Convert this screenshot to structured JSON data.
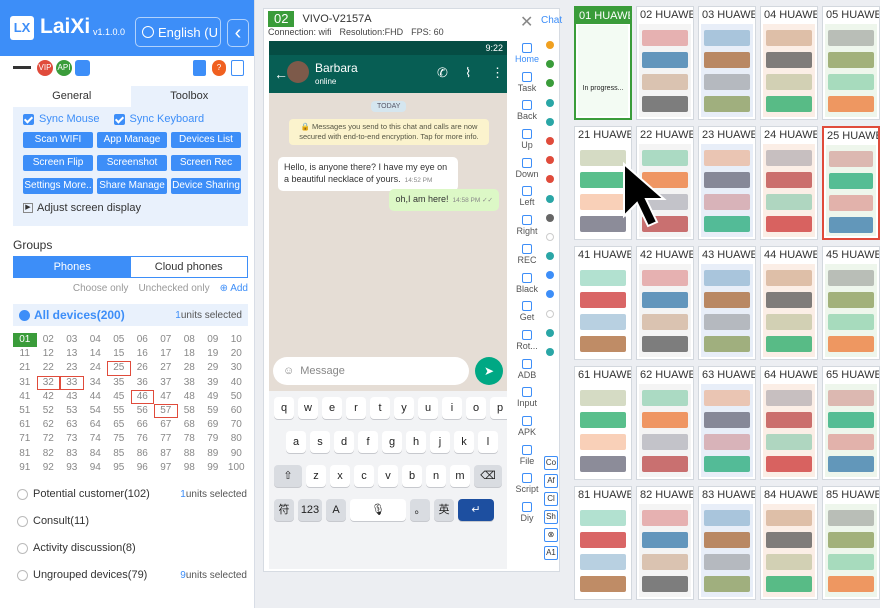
{
  "app": {
    "name": "LaiXi",
    "version": "v1.1.0.0",
    "logo": "LX",
    "language": "English (U",
    "back": "‹"
  },
  "badges": {
    "vip": "VIP",
    "api": "API"
  },
  "toolbox": {
    "tabs": [
      "General",
      "Toolbox"
    ],
    "sync_mouse": "Sync Mouse",
    "sync_keyboard": "Sync Keyboard",
    "buttons": [
      "Scan WIFI",
      "App Manage",
      "Devices List",
      "Screen Flip",
      "Screenshot",
      "Screen Rec",
      "Settings More..",
      "Share Manage",
      "Device Sharing"
    ],
    "adjust": "Adjust screen display"
  },
  "groups": {
    "title": "Groups",
    "tabs": [
      "Phones",
      "Cloud phones"
    ],
    "choose_only": "Choose only",
    "unchecked_only": "Unchecked only",
    "add": "⊕ Add",
    "all_devices": "All devices(200)",
    "all_units": "1",
    "units_selected": "units selected",
    "list": [
      {
        "name": "Potential customer(102)",
        "units": "1"
      },
      {
        "name": "Consult(11)",
        "units": ""
      },
      {
        "name": "Activity discussion(8)",
        "units": ""
      },
      {
        "name": "Ungrouped devices(79)",
        "units": "9"
      }
    ]
  },
  "device_numbers": [
    "01",
    "02",
    "03",
    "04",
    "05",
    "06",
    "07",
    "08",
    "09",
    "10",
    "11",
    "12",
    "13",
    "14",
    "15",
    "16",
    "17",
    "18",
    "19",
    "20",
    "21",
    "22",
    "23",
    "24",
    "25",
    "26",
    "27",
    "28",
    "29",
    "30",
    "31",
    "32",
    "33",
    "34",
    "35",
    "36",
    "37",
    "38",
    "39",
    "40",
    "41",
    "42",
    "43",
    "44",
    "45",
    "46",
    "47",
    "48",
    "49",
    "50",
    "51",
    "52",
    "53",
    "54",
    "55",
    "56",
    "57",
    "58",
    "59",
    "60",
    "61",
    "62",
    "63",
    "64",
    "65",
    "66",
    "67",
    "68",
    "69",
    "70",
    "71",
    "72",
    "73",
    "74",
    "75",
    "76",
    "77",
    "78",
    "79",
    "80",
    "81",
    "82",
    "83",
    "84",
    "85",
    "86",
    "87",
    "88",
    "89",
    "90",
    "91",
    "92",
    "93",
    "94",
    "95",
    "96",
    "97",
    "98",
    "99",
    "100"
  ],
  "device": {
    "number": "02",
    "name": "VIVO-V2157A",
    "connection": "Connection: wifi",
    "resolution": "Resolution:FHD",
    "fps": "FPS: 60",
    "chat_label": "Chat"
  },
  "phone": {
    "time": "9:22",
    "contact": "Barbara",
    "status": "online",
    "today": "TODAY",
    "encryption": "🔒 Messages you send to this chat and calls are now secured with end-to-end encryption. Tap for more info.",
    "msg_in": "Hello, is anyone there? I have my eye on a beautiful necklace of yours.",
    "msg_in_time": "14:52 PM",
    "msg_out": "oh,I am here!",
    "msg_out_time": "14:58 PM ✓✓",
    "input_placeholder": "Message",
    "keys_row1": [
      "q",
      "w",
      "e",
      "r",
      "t",
      "y",
      "u",
      "i",
      "o",
      "p"
    ],
    "keys_row2": [
      "a",
      "s",
      "d",
      "f",
      "g",
      "h",
      "j",
      "k",
      "l"
    ],
    "keys_row3": [
      "⇧",
      "z",
      "x",
      "c",
      "v",
      "b",
      "n",
      "m",
      "⌫"
    ],
    "keys_row4": [
      "符",
      "123",
      "A",
      "🎙",
      "。",
      "英",
      "↵"
    ]
  },
  "toolbar": [
    "Home",
    "Task",
    "Back",
    "Up",
    "Down",
    "Left",
    "Right",
    "REC",
    "Black",
    "Get",
    "Rot...",
    "ADB",
    "Input",
    "APK",
    "File",
    "Script",
    "Diy"
  ],
  "toolbar_colors": [
    "#f0a020",
    "#3a9c3a",
    "#3a9c3a",
    "#2aa6a6",
    "#2aa6a6",
    "#e04b3b",
    "#e04b3b",
    "#e04b3b",
    "#2aa6a6",
    "#666666",
    "#ffffff",
    "#2aa6a6",
    "#3d8ef8",
    "#3d8ef8",
    "#ffffff",
    "#2aa6a6",
    "#2aa6a6"
  ],
  "small_buttons": [
    "Co",
    "Af",
    "Cl",
    "Sh",
    "⊗",
    "A1"
  ],
  "tiles": [
    {
      "label": "01 HUAWE",
      "progress": "In progress..."
    },
    {
      "label": "02 HUAWE"
    },
    {
      "label": "03 HUAWE"
    },
    {
      "label": "04 HUAWE"
    },
    {
      "label": "05 HUAWE"
    },
    {
      "label": "21 HUAWE"
    },
    {
      "label": "22 HUAWE"
    },
    {
      "label": "23 HUAWE"
    },
    {
      "label": "24 HUAWE"
    },
    {
      "label": "25 HUAWE"
    },
    {
      "label": "41 HUAWE"
    },
    {
      "label": "42 HUAWE"
    },
    {
      "label": "43 HUAWE"
    },
    {
      "label": "44 HUAWE"
    },
    {
      "label": "45 HUAWE"
    },
    {
      "label": "61 HUAWE"
    },
    {
      "label": "62 HUAWE"
    },
    {
      "label": "63 HUAWE"
    },
    {
      "label": "64 HUAWE"
    },
    {
      "label": "65 HUAWE"
    },
    {
      "label": "81 HUAWE"
    },
    {
      "label": "82 HUAWE"
    },
    {
      "label": "83 HUAWE"
    },
    {
      "label": "84 HUAWE"
    },
    {
      "label": "85 HUAWE"
    }
  ],
  "colors": {
    "accent": "#3d8ef8",
    "selected": "#3a9c3a",
    "warning": "#e04b3b",
    "whatsapp": "#075e54"
  }
}
